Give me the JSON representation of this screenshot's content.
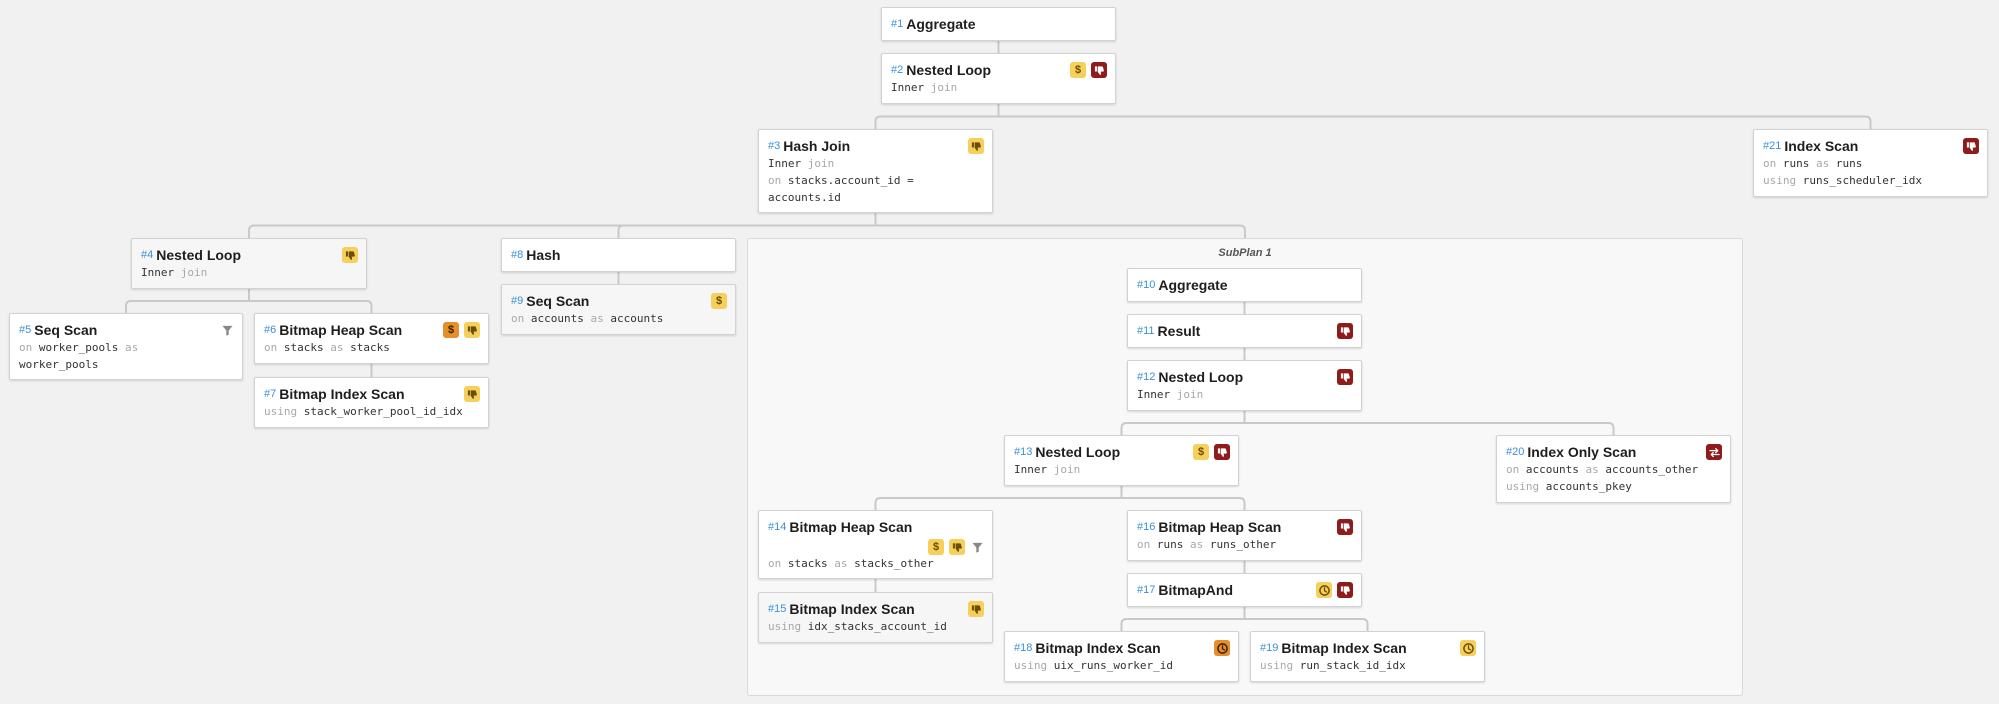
{
  "subplan": {
    "title": "SubPlan 1"
  },
  "nodes": [
    {
      "key": "n1",
      "id": "#1",
      "title": "Aggregate",
      "badges": [],
      "lines": []
    },
    {
      "key": "n2",
      "id": "#2",
      "title": "Nested Loop",
      "badges": [
        {
          "icon": "dollar-icon",
          "tone": "yellow"
        },
        {
          "icon": "thumbs-down-icon",
          "tone": "red"
        }
      ],
      "lines": [
        [
          {
            "t": "Inner",
            "k": false
          },
          {
            "t": " join",
            "k": true
          }
        ]
      ]
    },
    {
      "key": "n3",
      "id": "#3",
      "title": "Hash Join",
      "badges": [
        {
          "icon": "thumbs-down-icon",
          "tone": "yellow"
        }
      ],
      "lines": [
        [
          {
            "t": "Inner",
            "k": false
          },
          {
            "t": " join",
            "k": true
          }
        ],
        [
          {
            "t": "on ",
            "k": true
          },
          {
            "t": "stacks.account_id =",
            "k": false
          }
        ],
        [
          {
            "t": "accounts.id",
            "k": false
          }
        ]
      ]
    },
    {
      "key": "n4",
      "id": "#4",
      "title": "Nested Loop",
      "badges": [
        {
          "icon": "thumbs-down-icon",
          "tone": "yellow"
        }
      ],
      "lines": [
        [
          {
            "t": "Inner",
            "k": false
          },
          {
            "t": " join",
            "k": true
          }
        ]
      ]
    },
    {
      "key": "n5",
      "id": "#5",
      "title": "Seq Scan",
      "badges": [
        {
          "icon": "filter-icon",
          "tone": "plain"
        }
      ],
      "lines": [
        [
          {
            "t": "on ",
            "k": true
          },
          {
            "t": "worker_pools",
            "k": false
          },
          {
            "t": " as",
            "k": true
          }
        ],
        [
          {
            "t": "worker_pools",
            "k": false
          }
        ]
      ]
    },
    {
      "key": "n6",
      "id": "#6",
      "title": "Bitmap Heap Scan",
      "badges": [
        {
          "icon": "dollar-icon",
          "tone": "orange"
        },
        {
          "icon": "thumbs-down-icon",
          "tone": "yellow"
        }
      ],
      "lines": [
        [
          {
            "t": "on ",
            "k": true
          },
          {
            "t": "stacks",
            "k": false
          },
          {
            "t": " as ",
            "k": true
          },
          {
            "t": "stacks",
            "k": false
          }
        ]
      ]
    },
    {
      "key": "n7",
      "id": "#7",
      "title": "Bitmap Index Scan",
      "badges": [
        {
          "icon": "thumbs-down-icon",
          "tone": "yellow"
        }
      ],
      "lines": [
        [
          {
            "t": "using ",
            "k": true
          },
          {
            "t": "stack_worker_pool_id_idx",
            "k": false
          }
        ]
      ]
    },
    {
      "key": "n8",
      "id": "#8",
      "title": "Hash",
      "badges": [],
      "lines": []
    },
    {
      "key": "n9",
      "id": "#9",
      "title": "Seq Scan",
      "badges": [
        {
          "icon": "dollar-icon",
          "tone": "yellow"
        }
      ],
      "lines": [
        [
          {
            "t": "on ",
            "k": true
          },
          {
            "t": "accounts",
            "k": false
          },
          {
            "t": " as ",
            "k": true
          },
          {
            "t": "accounts",
            "k": false
          }
        ]
      ]
    },
    {
      "key": "n10",
      "id": "#10",
      "title": "Aggregate",
      "badges": [],
      "lines": []
    },
    {
      "key": "n11",
      "id": "#11",
      "title": "Result",
      "badges": [
        {
          "icon": "thumbs-down-icon",
          "tone": "red"
        }
      ],
      "lines": []
    },
    {
      "key": "n12",
      "id": "#12",
      "title": "Nested Loop",
      "badges": [
        {
          "icon": "thumbs-down-icon",
          "tone": "red"
        }
      ],
      "lines": [
        [
          {
            "t": "Inner",
            "k": false
          },
          {
            "t": " join",
            "k": true
          }
        ]
      ]
    },
    {
      "key": "n13",
      "id": "#13",
      "title": "Nested Loop",
      "badges": [
        {
          "icon": "dollar-icon",
          "tone": "yellow"
        },
        {
          "icon": "thumbs-down-icon",
          "tone": "red"
        }
      ],
      "lines": [
        [
          {
            "t": "Inner",
            "k": false
          },
          {
            "t": " join",
            "k": true
          }
        ]
      ]
    },
    {
      "key": "n14",
      "id": "#14",
      "title": "Bitmap Heap Scan",
      "badgesBelow": true,
      "badges": [
        {
          "icon": "dollar-icon",
          "tone": "yellow"
        },
        {
          "icon": "thumbs-down-icon",
          "tone": "yellow"
        },
        {
          "icon": "filter-icon",
          "tone": "plain"
        }
      ],
      "lines": [
        [
          {
            "t": "on ",
            "k": true
          },
          {
            "t": "stacks",
            "k": false
          },
          {
            "t": " as ",
            "k": true
          },
          {
            "t": "stacks_other",
            "k": false
          }
        ]
      ]
    },
    {
      "key": "n15",
      "id": "#15",
      "title": "Bitmap Index Scan",
      "badges": [
        {
          "icon": "thumbs-down-icon",
          "tone": "yellow"
        }
      ],
      "lines": [
        [
          {
            "t": "using ",
            "k": true
          },
          {
            "t": "idx_stacks_account_id",
            "k": false
          }
        ]
      ]
    },
    {
      "key": "n16",
      "id": "#16",
      "title": "Bitmap Heap Scan",
      "badges": [
        {
          "icon": "thumbs-down-icon",
          "tone": "red"
        }
      ],
      "lines": [
        [
          {
            "t": "on ",
            "k": true
          },
          {
            "t": "runs",
            "k": false
          },
          {
            "t": " as ",
            "k": true
          },
          {
            "t": "runs_other",
            "k": false
          }
        ]
      ]
    },
    {
      "key": "n17",
      "id": "#17",
      "title": "BitmapAnd",
      "badges": [
        {
          "icon": "clock-icon",
          "tone": "yellow"
        },
        {
          "icon": "thumbs-down-icon",
          "tone": "red"
        }
      ],
      "lines": []
    },
    {
      "key": "n18",
      "id": "#18",
      "title": "Bitmap Index Scan",
      "badges": [
        {
          "icon": "clock-icon",
          "tone": "orange"
        }
      ],
      "lines": [
        [
          {
            "t": "using ",
            "k": true
          },
          {
            "t": "uix_runs_worker_id",
            "k": false
          }
        ]
      ]
    },
    {
      "key": "n19",
      "id": "#19",
      "title": "Bitmap Index Scan",
      "badges": [
        {
          "icon": "clock-icon",
          "tone": "yellow"
        }
      ],
      "lines": [
        [
          {
            "t": "using ",
            "k": true
          },
          {
            "t": "run_stack_id_idx",
            "k": false
          }
        ]
      ]
    },
    {
      "key": "n20",
      "id": "#20",
      "title": "Index Only Scan",
      "badges": [
        {
          "icon": "swap-icon",
          "tone": "red"
        }
      ],
      "lines": [
        [
          {
            "t": "on ",
            "k": true
          },
          {
            "t": "accounts",
            "k": false
          },
          {
            "t": " as ",
            "k": true
          },
          {
            "t": "accounts_other",
            "k": false
          }
        ],
        [
          {
            "t": "using ",
            "k": true
          },
          {
            "t": "accounts_pkey",
            "k": false
          }
        ]
      ]
    },
    {
      "key": "n21",
      "id": "#21",
      "title": "Index Scan",
      "badges": [
        {
          "icon": "thumbs-down-icon",
          "tone": "red"
        }
      ],
      "lines": [
        [
          {
            "t": "on ",
            "k": true
          },
          {
            "t": "runs",
            "k": false
          },
          {
            "t": " as ",
            "k": true
          },
          {
            "t": "runs",
            "k": false
          }
        ],
        [
          {
            "t": "using ",
            "k": true
          },
          {
            "t": "runs_scheduler_idx",
            "k": false
          }
        ]
      ]
    }
  ],
  "edges": [
    [
      "n1",
      "n2"
    ],
    [
      "n2",
      "n3"
    ],
    [
      "n2",
      "n21"
    ],
    [
      "n3",
      "n4"
    ],
    [
      "n3",
      "n8"
    ],
    [
      "n3",
      "subplan"
    ],
    [
      "n4",
      "n5"
    ],
    [
      "n4",
      "n6"
    ],
    [
      "n6",
      "n7"
    ],
    [
      "n8",
      "n9"
    ],
    [
      "n10",
      "n11"
    ],
    [
      "n11",
      "n12"
    ],
    [
      "n12",
      "n13"
    ],
    [
      "n12",
      "n20"
    ],
    [
      "n13",
      "n14"
    ],
    [
      "n13",
      "n16"
    ],
    [
      "n14",
      "n15"
    ],
    [
      "n16",
      "n17"
    ],
    [
      "n17",
      "n18"
    ],
    [
      "n17",
      "n19"
    ]
  ]
}
